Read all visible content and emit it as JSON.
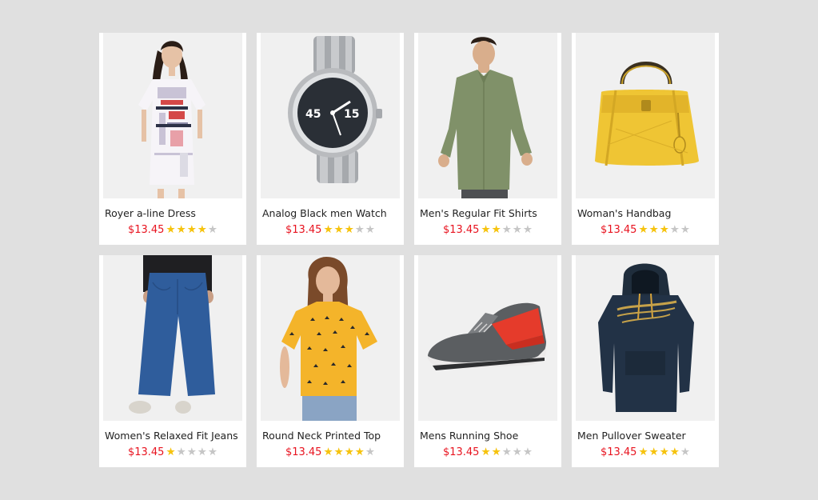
{
  "theme": {
    "price_color": "#e8131f",
    "star_on": "#f6c30e",
    "star_off": "#c6c6c6"
  },
  "products": [
    {
      "title": "Royer a-line Dress",
      "price": "$13.45",
      "rating": 4,
      "max_rating": 5,
      "image": "dress-image"
    },
    {
      "title": "Analog Black men Watch",
      "price": "$13.45",
      "rating": 3,
      "max_rating": 5,
      "image": "watch-image"
    },
    {
      "title": "Men's Regular Fit Shirts",
      "price": "$13.45",
      "rating": 2,
      "max_rating": 5,
      "image": "shirt-image"
    },
    {
      "title": "Woman's Handbag",
      "price": "$13.45",
      "rating": 3,
      "max_rating": 5,
      "image": "handbag-image"
    },
    {
      "title": "Women's Relaxed Fit Jeans",
      "price": "$13.45",
      "rating": 1,
      "max_rating": 5,
      "image": "jeans-image"
    },
    {
      "title": "Round Neck Printed Top",
      "price": "$13.45",
      "rating": 4,
      "max_rating": 5,
      "image": "top-image"
    },
    {
      "title": "Mens Running Shoe",
      "price": "$13.45",
      "rating": 2,
      "max_rating": 5,
      "image": "shoe-image"
    },
    {
      "title": "Men Pullover Sweater",
      "price": "$13.45",
      "rating": 4,
      "max_rating": 5,
      "image": "sweater-image"
    }
  ]
}
